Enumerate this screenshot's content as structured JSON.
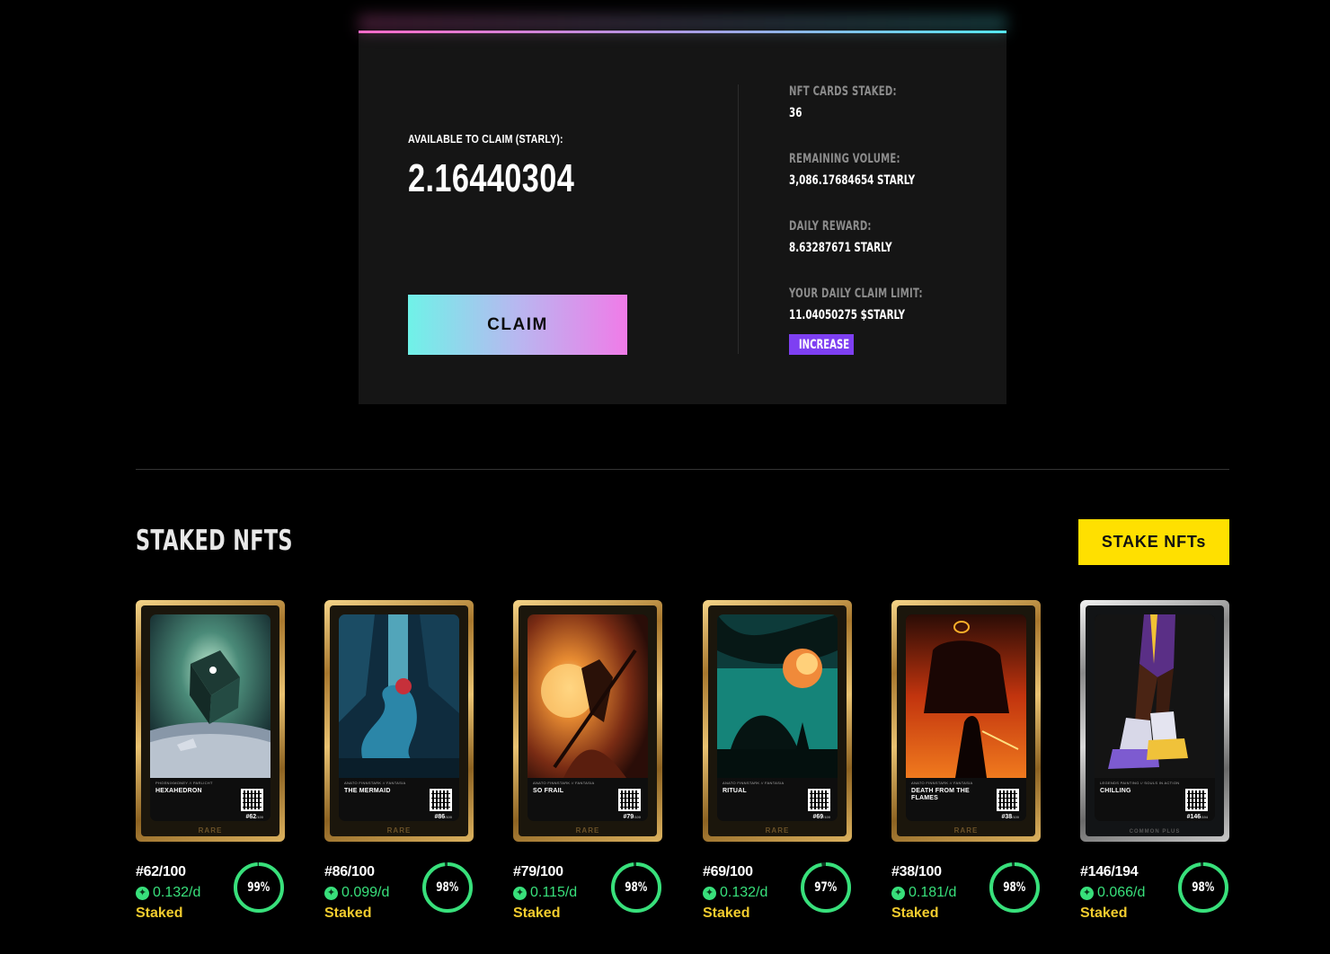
{
  "claim": {
    "available_label": "AVAILABLE TO CLAIM (STARLY):",
    "available_value": "2.16440304",
    "claim_button": "CLAIM"
  },
  "stats": {
    "cards_staked_label": "NFT CARDS STAKED:",
    "cards_staked_value": "36",
    "remaining_volume_label": "REMAINING VOLUME:",
    "remaining_volume_value": "3,086.17684654 STARLY",
    "daily_reward_label": "DAILY REWARD:",
    "daily_reward_value": "8.63287671 STARLY",
    "daily_limit_label": "YOUR DAILY CLAIM LIMIT:",
    "daily_limit_value": "11.04050275 $STARLY",
    "increase_button": "INCREASE"
  },
  "section": {
    "title": "STAKED NFTS",
    "stake_button": "STAKE NFTs"
  },
  "colors": {
    "accent_gradient_start": "#6ff2e8",
    "accent_gradient_end": "#f07be8",
    "stake_button": "#ffe000",
    "increase_badge": "#7e3ff2",
    "reward_green": "#38e07b",
    "staked_yellow": "#f2cc2e"
  },
  "nfts": [
    {
      "card_meta": "PHOENIXMONEY // PARLICHT",
      "card_title": "HEXAHEDRON",
      "card_edition": "#62",
      "card_edition_total": "/100",
      "rarity": "RARE",
      "edition": "#62/100",
      "rate": "0.132/d",
      "status": "Staked",
      "percent_label": "99%",
      "percent": 99
    },
    {
      "card_meta": "ANATO FINNSTARK // FANTASIA",
      "card_title": "THE MERMAID",
      "card_edition": "#86",
      "card_edition_total": "/100",
      "rarity": "RARE",
      "edition": "#86/100",
      "rate": "0.099/d",
      "status": "Staked",
      "percent_label": "98%",
      "percent": 98
    },
    {
      "card_meta": "ANATO FINNSTARK // FANTASIA",
      "card_title": "SO FRAIL",
      "card_edition": "#79",
      "card_edition_total": "/100",
      "rarity": "RARE",
      "edition": "#79/100",
      "rate": "0.115/d",
      "status": "Staked",
      "percent_label": "98%",
      "percent": 98
    },
    {
      "card_meta": "ANATO FINNSTARK // FANTASIA",
      "card_title": "RITUAL",
      "card_edition": "#69",
      "card_edition_total": "/100",
      "rarity": "RARE",
      "edition": "#69/100",
      "rate": "0.132/d",
      "status": "Staked",
      "percent_label": "97%",
      "percent": 97
    },
    {
      "card_meta": "ANATO FINNSTARK // FANTASIA",
      "card_title": "DEATH FROM THE FLAMES",
      "card_edition": "#38",
      "card_edition_total": "/100",
      "rarity": "RARE",
      "edition": "#38/100",
      "rate": "0.181/d",
      "status": "Staked",
      "percent_label": "98%",
      "percent": 98
    },
    {
      "card_meta": "LEGENDS PAINTING // SOULS IN ACTION",
      "card_title": "CHILLING",
      "card_edition": "#146",
      "card_edition_total": "/194",
      "rarity": "COMMON PLUS",
      "edition": "#146/194",
      "rate": "0.066/d",
      "status": "Staked",
      "percent_label": "98%",
      "percent": 98
    }
  ]
}
